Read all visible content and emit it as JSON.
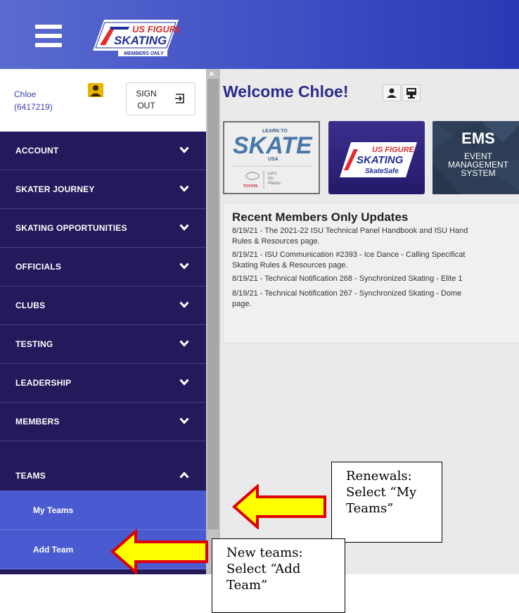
{
  "header": {
    "logo_text": "US FIGURE SKATING",
    "logo_sub": "MEMBERS ONLY"
  },
  "user": {
    "name": "Chloe",
    "id": "(6417219)"
  },
  "signout": {
    "label": "SIGN\nOUT"
  },
  "menu": [
    {
      "label": "ACCOUNT",
      "expanded": false
    },
    {
      "label": "SKATER JOURNEY",
      "expanded": false
    },
    {
      "label": "SKATING OPPORTUNITIES",
      "expanded": false
    },
    {
      "label": "OFFICIALS",
      "expanded": false
    },
    {
      "label": "CLUBS",
      "expanded": false
    },
    {
      "label": "TESTING",
      "expanded": false
    },
    {
      "label": "LEADERSHIP",
      "expanded": false
    },
    {
      "label": "MEMBERS",
      "expanded": false
    },
    {
      "label": "TEAMS",
      "expanded": true
    }
  ],
  "teams_submenu": [
    {
      "label": "My Teams"
    },
    {
      "label": "Add Team"
    }
  ],
  "main": {
    "welcome": "Welcome Chloe!",
    "tiles": {
      "learn_to": "LEARN TO",
      "skate": "SKATE",
      "usa": "USA",
      "toyota": "TOYOTA",
      "lets_go": "Let's\nGo\nPlaces",
      "skatesafe_logo": "US FIGURE SKATING",
      "skatesafe": "SkateSafe",
      "ems_title": "EMS",
      "ems_sub": "EVENT\nMANAGEMENT\nSYSTEM"
    },
    "updates_title": "Recent Members Only Updates",
    "updates": [
      "8/19/21 - The 2021-22 ISU Technical Panel Handbook and ISU Hand\nRules & Resources page.",
      "8/19/21 - ISU Communication #2393 - Ice Dance - Calling Specificat\nSkating Rules & Resources page.",
      "8/19/21 - Technical Notification 268 - Synchronized Skating - Elite 1",
      "8/19/21 - Technical Notification 267 - Synchronized Skating - Dome\npage."
    ]
  },
  "annotations": {
    "renewals": "Renewals:\nSelect “My\nTeams”",
    "new_teams": "New teams:\nSelect “Add\nTeam”"
  },
  "colors": {
    "header": "#3f4fc4",
    "sidebar": "#24195a",
    "submenu": "#4a5ad0",
    "arrow_fill": "#ffff00",
    "arrow_stroke": "#e00000"
  }
}
